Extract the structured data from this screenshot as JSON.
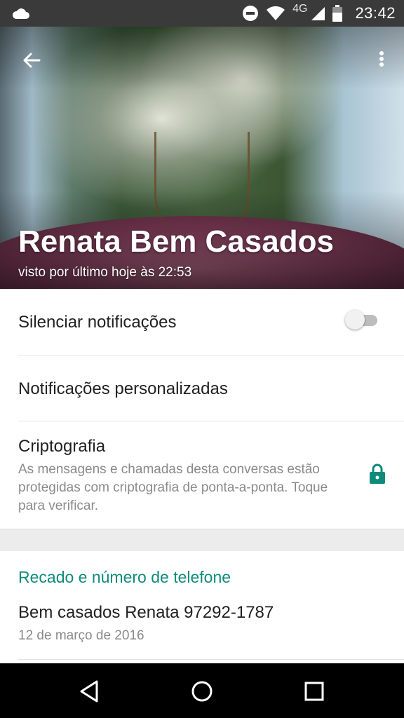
{
  "status_bar": {
    "time": "23:42",
    "network": "4G",
    "icons": [
      "cloud-icon",
      "do-not-disturb-icon",
      "wifi-icon",
      "signal-icon",
      "battery-icon"
    ]
  },
  "header": {
    "contact_name": "Renata Bem Casados",
    "last_seen": "visto por último hoje às 22:53",
    "icons": [
      "back-arrow-icon",
      "overflow-menu-icon"
    ]
  },
  "settings": {
    "mute_label": "Silenciar notificações",
    "mute_enabled": false,
    "custom_notifications_label": "Notificações personalizadas",
    "encryption_title": "Criptografia",
    "encryption_desc": "As mensagens e chamadas desta conversas estão protegidas com criptografia de ponta-a-ponta. Toque para verificar."
  },
  "about": {
    "section_title": "Recado e número de telefone",
    "status_text": "Bem casados Renata 97292-1787",
    "status_date": "12 de março de 2016"
  },
  "colors": {
    "accent": "#0f8a7b",
    "status_bar": "#3a3a3a",
    "nav_bar": "#000000",
    "section_gap": "#ececec"
  }
}
